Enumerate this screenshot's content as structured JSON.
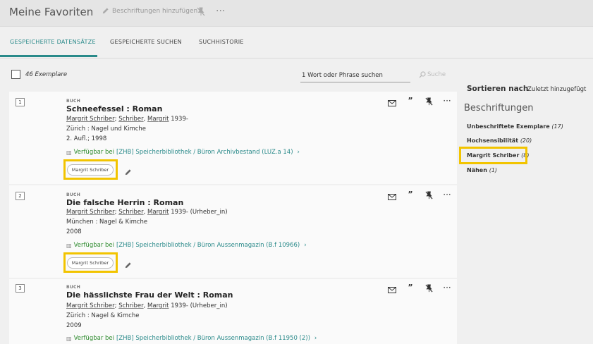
{
  "header": {
    "title": "Meine Favoriten",
    "edit_labels": "Beschriftungen hinzufügen"
  },
  "tabs": [
    {
      "label": "GESPEICHERTE DATENSÄTZE",
      "active": true
    },
    {
      "label": "GESPEICHERTE SUCHEN",
      "active": false
    },
    {
      "label": "SUCHHISTORIE",
      "active": false
    }
  ],
  "list": {
    "count": "46 Exemplare",
    "search_value": "1 Wort oder Phrase suchen",
    "search_button": "Suche"
  },
  "records": [
    {
      "num": "1",
      "type": "BUCH",
      "title": "Schneefessel : Roman",
      "author_a": "Margrit Schriber",
      "author_b": "Schriber",
      "author_c": "Margrit",
      "author_rest": " 1939-",
      "publisher": "Zürich : Nagel und Kimche",
      "edition": "2. Aufl.; 1998",
      "avail_status": "Verfügbar bei",
      "avail_location": "[ZHB] Speicherbibliothek / Büron  Archivbestand (LUZ.a 14)",
      "tag": "Margrit Schriber"
    },
    {
      "num": "2",
      "type": "BUCH",
      "title": "Die falsche Herrin : Roman",
      "author_a": "Margrit Schriber",
      "author_b": "Schriber",
      "author_c": "Margrit",
      "author_rest": " 1939- (Urheber_in)",
      "publisher": "München : Nagel & Kimche",
      "edition": "2008",
      "avail_status": "Verfügbar bei",
      "avail_location": "[ZHB] Speicherbibliothek / Büron  Aussenmagazin (B.f 10966)",
      "tag": "Margrit Schriber"
    },
    {
      "num": "3",
      "type": "BUCH",
      "title": "Die hässlichste Frau der Welt : Roman",
      "author_a": "Margrit Schriber",
      "author_b": "Schriber",
      "author_c": "Margrit",
      "author_rest": " 1939- (Urheber_in)",
      "publisher": "Zürich : Nagel & Kimche",
      "edition": "2009",
      "avail_status": "Verfügbar bei",
      "avail_location": "[ZHB] Speicherbibliothek / Büron  Aussenmagazin (B.f 11950 (2))"
    }
  ],
  "sidebar": {
    "sort_label": "Sortieren nach",
    "sort_value": "Zuletzt hinzugefügt",
    "labels_heading": "Beschriftungen",
    "labels": [
      {
        "name": "Unbeschriftete Exemplare",
        "count": "(17)"
      },
      {
        "name": "Hochsensibilität",
        "count": "(20)"
      },
      {
        "name": "Margrit Schriber",
        "count": "(8)"
      },
      {
        "name": "Nähen",
        "count": "(1)"
      }
    ]
  },
  "colors": {
    "accent": "#2a8a8a",
    "available": "#2e8b2e",
    "highlight": "#f2c400"
  },
  "icons": [
    "pencil-icon",
    "pin-off-icon",
    "more-icon",
    "email-icon",
    "quote-icon",
    "search-icon",
    "book-icon",
    "chevron-right-icon"
  ]
}
